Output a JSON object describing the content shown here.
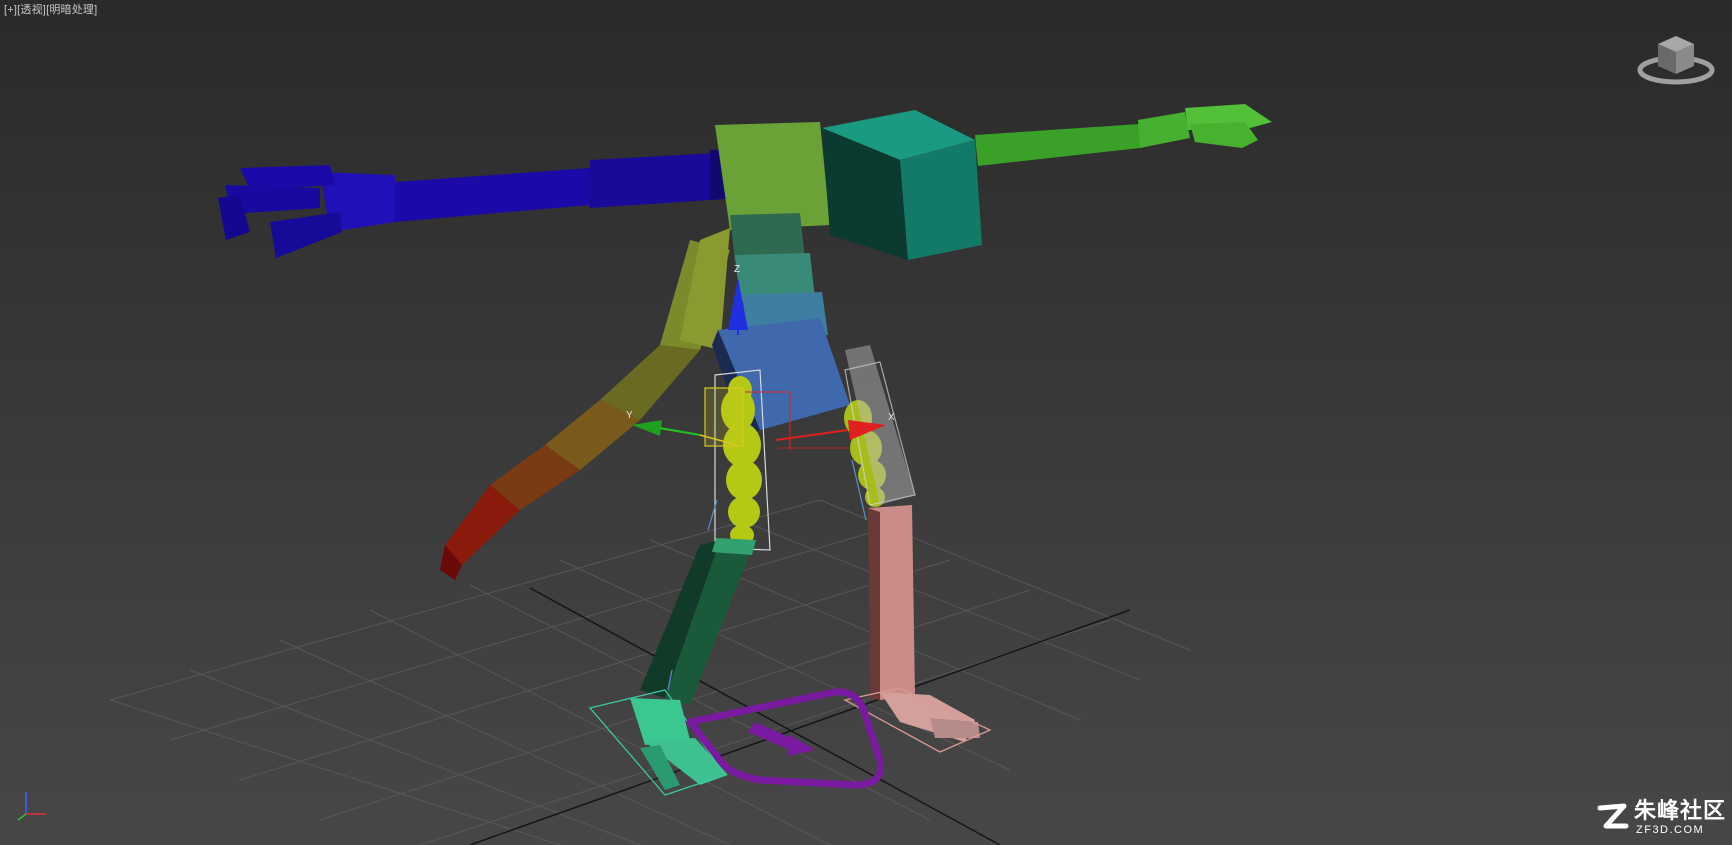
{
  "viewport": {
    "menu_plus": "[+]",
    "view_mode": "[透视]",
    "shading_mode": "[明暗处理]"
  },
  "gizmo": {
    "z_label": "Z",
    "x_label": "X",
    "y_label": "Y"
  },
  "watermark": {
    "title": "朱峰社区",
    "url": "ZF3D.COM"
  },
  "colors": {
    "left_arm": "#1c0aa8",
    "right_arm": "#3aa028",
    "head_box": "#147a68",
    "torso_top": "#6aa238",
    "pelvis": "#3f68ad",
    "left_leg": "#1a5a3a",
    "right_leg": "#c98c88",
    "tail_end": "#8a0a0a",
    "spline_control": "#7a1aa0",
    "gizmo_x": "#e02020",
    "gizmo_y": "#20c020",
    "gizmo_z": "#2030e0"
  },
  "icons": {
    "viewcube": "viewcube-icon",
    "axis": "axis-tripod-icon",
    "brand": "zf-logo-icon"
  }
}
